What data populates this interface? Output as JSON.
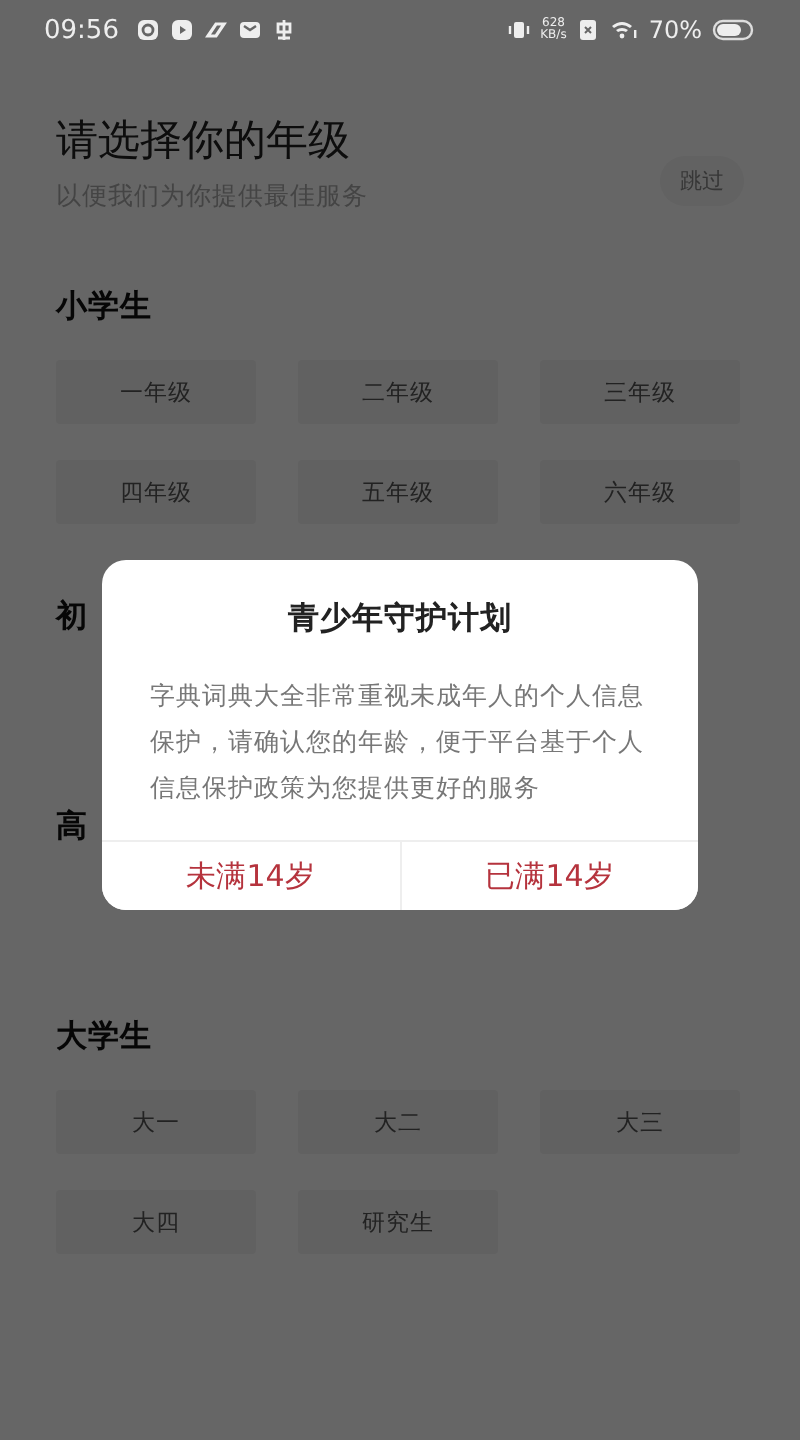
{
  "status_bar": {
    "time": "09:56",
    "net_speed": "628",
    "net_unit": "KB/s",
    "battery": "70%"
  },
  "header": {
    "title": "请选择你的年级",
    "subtitle": "以便我们为你提供最佳服务",
    "skip": "跳过"
  },
  "sections": [
    {
      "title": "小学生",
      "grades": [
        "一年级",
        "二年级",
        "三年级",
        "四年级",
        "五年级",
        "六年级"
      ]
    },
    {
      "title": "初"
    },
    {
      "title": "高"
    },
    {
      "title": "大学生",
      "grades": [
        "大一",
        "大二",
        "大三",
        "大四",
        "研究生"
      ]
    }
  ],
  "dialog": {
    "title": "青少年守护计划",
    "body": "字典词典大全非常重视未成年人的个人信息保护，请确认您的年龄，便于平台基于个人信息保护政策为您提供更好的服务",
    "buttons": [
      "未满14岁",
      "已满14岁"
    ]
  }
}
